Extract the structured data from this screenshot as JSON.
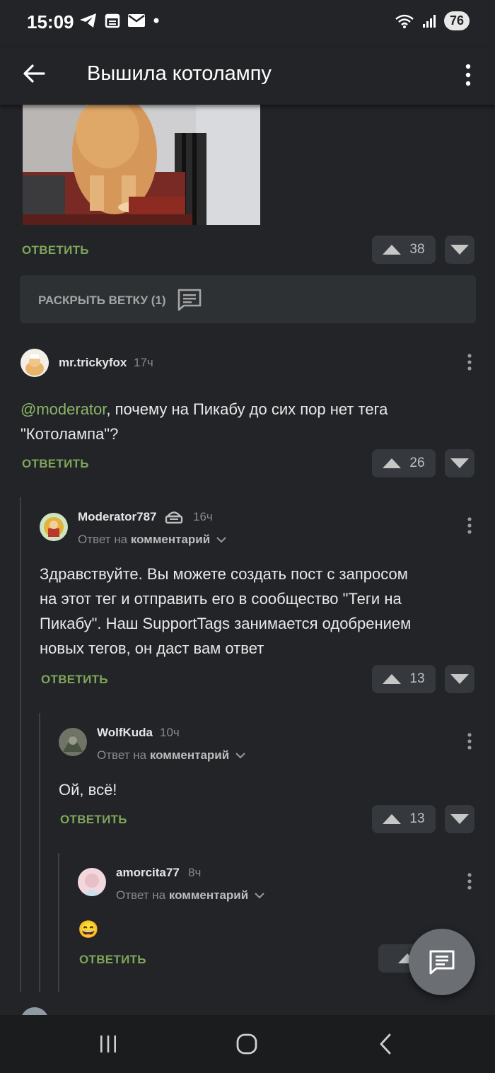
{
  "status_bar": {
    "time": "15:09",
    "battery": "76"
  },
  "app_bar": {
    "title": "Вышила котолампу"
  },
  "top_post": {
    "reply_label": "ОТВЕТИТЬ",
    "votes": "38"
  },
  "expand_thread": {
    "label": "РАСКРЫТЬ ВЕТКУ (1)"
  },
  "comments": [
    {
      "username": "mr.trickyfox",
      "time": "17ч",
      "mention": "@moderator",
      "text_line1": ", почему на Пикабу до сих пор нет тега",
      "text_line2": "\"Котолампа\"?",
      "reply_label": "ОТВЕТИТЬ",
      "votes": "26"
    },
    {
      "username": "Moderator787",
      "time": "16ч",
      "reply_prefix": "Ответ на",
      "reply_target": "комментарий",
      "text_lines": [
        "Здравствуйте. Вы можете создать пост с запросом",
        "на этот тег и отправить его в сообщество \"Теги на",
        "Пикабу\". Наш SupportTags занимается одобрением",
        "новых тегов, он даст вам ответ"
      ],
      "reply_label": "ОТВЕТИТЬ",
      "votes": "13"
    },
    {
      "username": "WolfKuda",
      "time": "10ч",
      "reply_prefix": "Ответ на",
      "reply_target": "комментарий",
      "text": "Ой, всё!",
      "reply_label": "ОТВЕТИТЬ",
      "votes": "13"
    },
    {
      "username": "amorcita77",
      "time": "8ч",
      "reply_prefix": "Ответ на",
      "reply_target": "комментарий",
      "text": "😄",
      "reply_label": "ОТВЕТИТЬ"
    }
  ],
  "colors": {
    "background": "#222427",
    "accent_green": "#7ea55a",
    "mention": "#8cb569",
    "vote_box": "#35383c"
  }
}
